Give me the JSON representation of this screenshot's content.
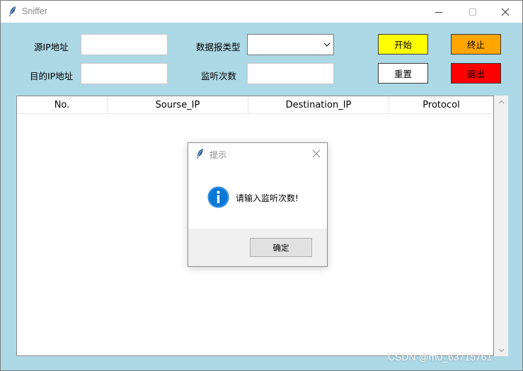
{
  "window": {
    "title": "Sniffer"
  },
  "form": {
    "src_ip_label": "源IP地址",
    "src_ip_value": "",
    "dst_ip_label": "目的IP地址",
    "dst_ip_value": "",
    "packet_type_label": "数据报类型",
    "packet_type_value": "",
    "listen_count_label": "监听次数",
    "listen_count_value": ""
  },
  "buttons": {
    "start": {
      "label": "开始",
      "color": "#ffff00"
    },
    "stop": {
      "label": "终止",
      "color": "#ffa500"
    },
    "reset": {
      "label": "重置",
      "color": "#ffffff"
    },
    "exit": {
      "label": "退出",
      "color": "#ff0000"
    }
  },
  "table": {
    "columns": [
      "No.",
      "Sourse_IP",
      "Destination_IP",
      "Protocol"
    ],
    "rows": []
  },
  "dialog": {
    "title": "提示",
    "message": "请输入监听次数!",
    "ok_label": "确定",
    "icon": "info-icon"
  },
  "watermark": "CSDN @m0_63715761",
  "colors": {
    "window_bg": "#add8e6",
    "info_blue": "#0a78d7"
  }
}
